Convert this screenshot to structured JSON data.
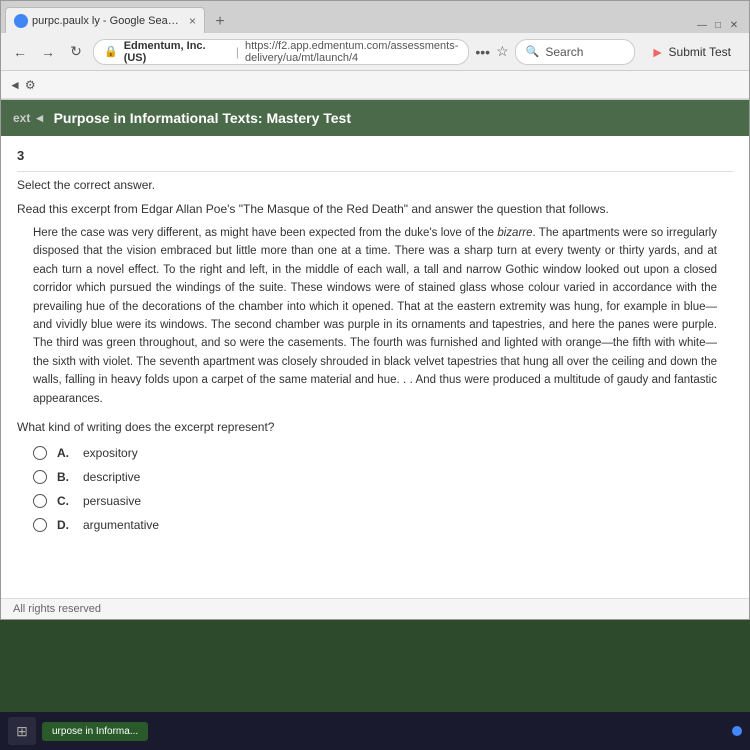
{
  "browser": {
    "tab": {
      "label": "purpc.paulx ly - Google Search",
      "close": "×",
      "add": "+"
    },
    "address": {
      "lock_icon": "🔒",
      "site": "Edmentum, Inc. (US)",
      "separator": "|",
      "url": "https://f2.app.edmentum.com/assessments-delivery/ua/mt/launch/4"
    },
    "search": {
      "placeholder": "Search"
    },
    "submit_btn": "Submit Test"
  },
  "page": {
    "title": "Purpose in Informational Texts: Mastery Test",
    "nav_arrow": "◄",
    "settings_icon": "⚙"
  },
  "question": {
    "number": "3",
    "instruction": "Select the correct answer.",
    "passage_intro": "Read this excerpt from Edgar Allan Poe's \"The Masque of the Red Death\" and answer the question that follows.",
    "passage": "Here the case was very different, as might have been expected from the duke's love of the bizarre. The apartments were so irregularly disposed that the vision embraced but little more than one at a time. There was a sharp turn at every twenty or thirty yards, and at each turn a novel effect. To the right and left, in the middle of each wall, a tall and narrow Gothic window looked out upon a closed corridor which pursued the windings of the suite. These windows were of stained glass whose colour varied in accordance with the prevailing hue of the decorations of the chamber into which it opened. That at the eastern extremity was hung, for example in blue—and vividly blue were its windows. The second chamber was purple in its ornaments and tapestries, and here the panes were purple. The third was green throughout, and so were the casements. The fourth was furnished and lighted with orange—the fifth with white—the sixth with violet. The seventh apartment was closely shrouded in black velvet tapestries that hung all over the ceiling and down the walls, falling in heavy folds upon a carpet of the same material and hue. . . And thus were produced a multitude of gaudy and fantastic appearances.",
    "question_text": "What kind of writing does the excerpt represent?",
    "options": [
      {
        "letter": "A.",
        "text": "expository"
      },
      {
        "letter": "B.",
        "text": "descriptive"
      },
      {
        "letter": "C.",
        "text": "persuasive"
      },
      {
        "letter": "D.",
        "text": "argumentative"
      }
    ]
  },
  "footer": {
    "text": "All rights reserved"
  },
  "taskbar": {
    "item_label": "urpose in Informa..."
  },
  "icons": {
    "back": "←",
    "forward": "→",
    "refresh": "↻",
    "home": "⌂",
    "dots": "•••",
    "star": "☆",
    "search": "🔍",
    "submit_arrow": "►"
  }
}
